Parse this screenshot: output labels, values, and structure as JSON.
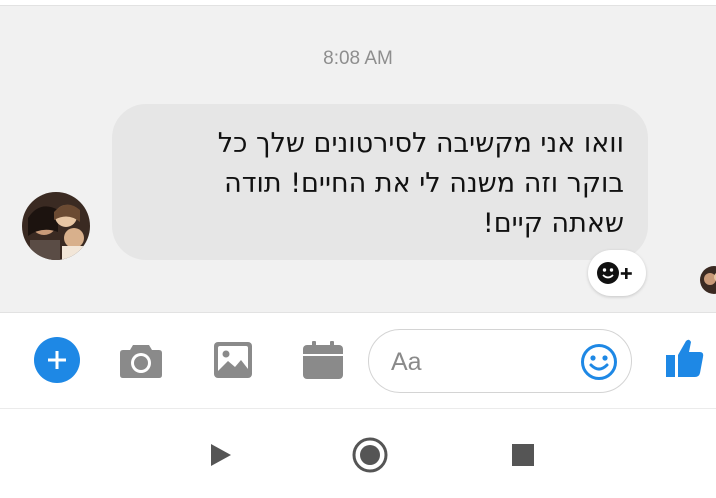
{
  "conversation": {
    "timestamp": "8:08 AM",
    "message": {
      "text": "וואו אני מקשיבה לסירטונים שלך כל\nבוקר וזה משנה לי את החיים! תודה\nשאתה קיים!",
      "direction": "rtl"
    }
  },
  "composer": {
    "placeholder": "Aa",
    "icons": [
      "plus-icon",
      "camera-icon",
      "image-icon",
      "calendar-icon",
      "smiley-icon",
      "thumbs-up-icon"
    ]
  },
  "navbar": {
    "icons": [
      "back-triangle-icon",
      "home-circle-icon",
      "recents-square-icon"
    ]
  },
  "colors": {
    "accent": "#1e88e5",
    "bubble": "#e6e6e6",
    "chat_background": "#f1f1f1",
    "icon_gray": "#8a8a8a",
    "timestamp": "#8e8e8e"
  }
}
